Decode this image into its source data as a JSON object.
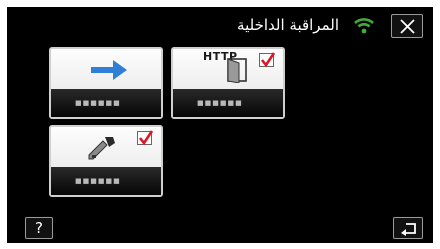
{
  "header": {
    "title": "المراقبة الداخلية",
    "wifi_icon": "wifi-icon",
    "close_icon": "close-icon"
  },
  "tiles": [
    {
      "name": "tile-arrow",
      "icon": "arrow-right-icon",
      "label": "■■■■■■",
      "checked": false
    },
    {
      "name": "tile-http",
      "icon": "http-door-icon",
      "icon_text": "HTTP",
      "label": "■■■■■■",
      "checked": true
    },
    {
      "name": "tile-key",
      "icon": "key-icon",
      "label": "■■■■■■",
      "checked": true
    }
  ],
  "footer": {
    "help_label": "?",
    "back_icon": "return-icon"
  },
  "colors": {
    "accent_green": "#3fae35",
    "arrow_blue": "#2f7fd6",
    "check_red": "#d8192a",
    "background": "#000000"
  }
}
